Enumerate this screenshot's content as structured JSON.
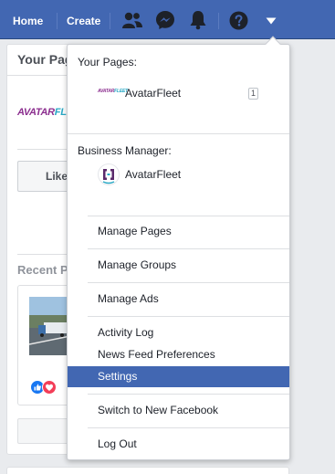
{
  "topbar": {
    "home_label": "Home",
    "create_label": "Create",
    "icons": [
      "friends-icon",
      "messenger-icon",
      "notifications-icon",
      "help-icon",
      "account-menu-caret-icon"
    ]
  },
  "background": {
    "your_pages_title": "Your Pag",
    "like_label": "Like",
    "recent_title": "Recent P"
  },
  "dropdown": {
    "your_pages_label": "Your Pages:",
    "page_name": "AvatarFleet",
    "page_badge": "1",
    "business_label": "Business Manager:",
    "business_name": "AvatarFleet",
    "items": {
      "manage_pages": "Manage Pages",
      "manage_groups": "Manage Groups",
      "manage_ads": "Manage Ads",
      "activity_log": "Activity Log",
      "news_feed": "News Feed Preferences",
      "settings": "Settings",
      "switch": "Switch to New Facebook",
      "logout": "Log Out"
    }
  },
  "colors": {
    "brand_blue": "#4267b2",
    "like_blue": "#1877f2",
    "love_red": "#f33e58"
  }
}
